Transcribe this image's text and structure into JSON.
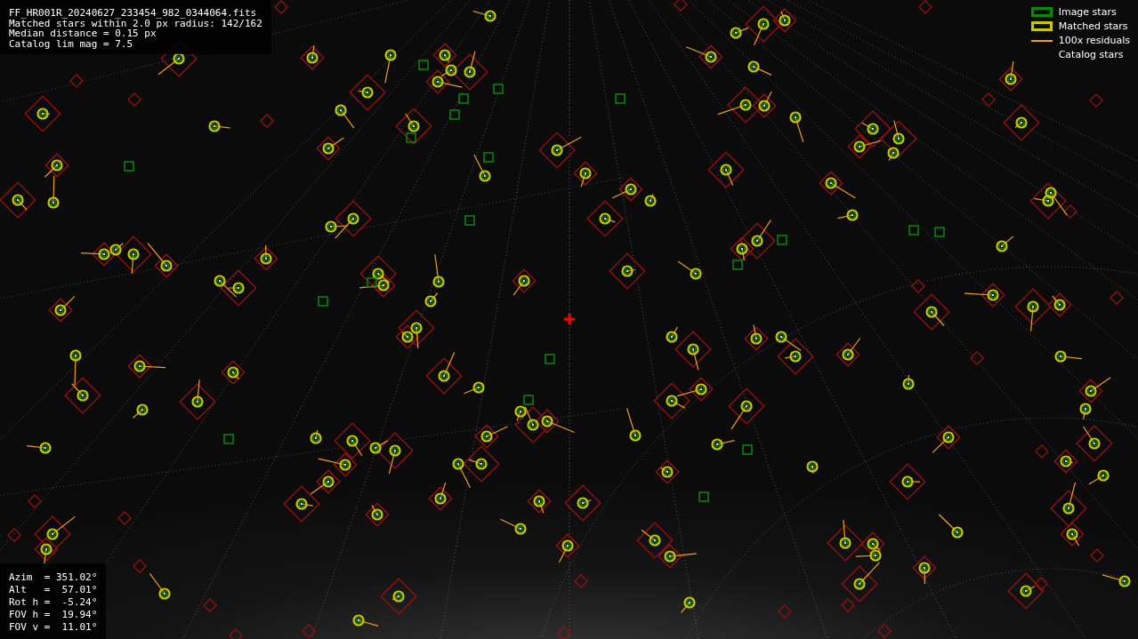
{
  "header": {
    "lines": [
      "FF_HR001R_20240627_233454_982_0344064.fits",
      "Matched stars within 2.0 px radius: 142/162",
      "Median distance = 0.15 px",
      "Catalog lim mag = 7.5"
    ]
  },
  "legend": [
    {
      "kind": "image",
      "label": "Image stars"
    },
    {
      "kind": "matched",
      "label": "Matched stars"
    },
    {
      "kind": "residual",
      "label": "100x residuals"
    },
    {
      "kind": "catalog",
      "label": "Catalog stars"
    }
  ],
  "pointing": {
    "lines": [
      "Azim  = 351.02°",
      "Alt   =  57.01°",
      "Rot h =  -5.24°",
      "FOV h =  19.94°",
      "FOV v =  11.01°"
    ]
  }
}
